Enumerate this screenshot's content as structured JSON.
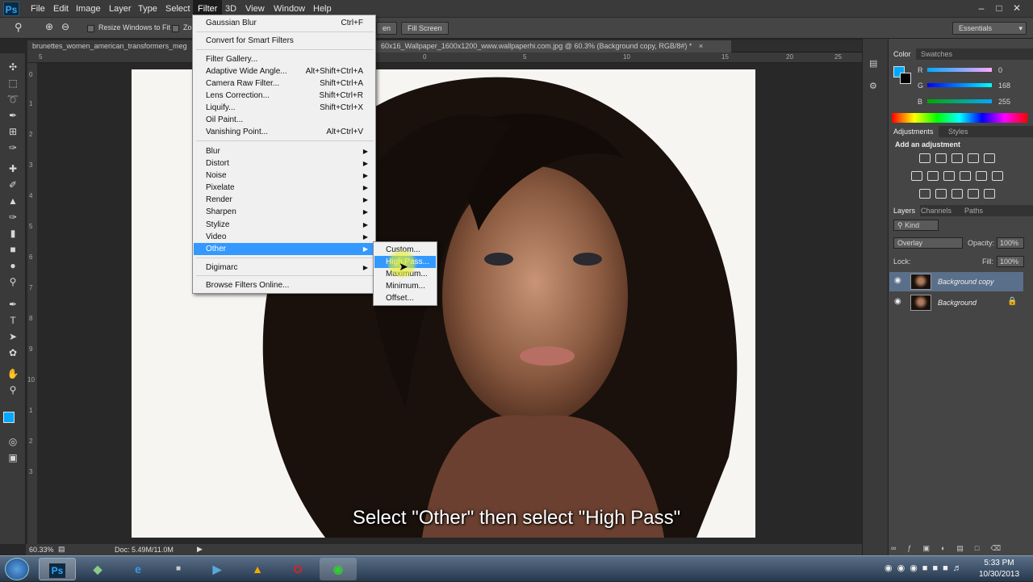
{
  "app": {
    "logo": "Ps"
  },
  "menubar": {
    "items": [
      "File",
      "Edit",
      "Image",
      "Layer",
      "Type",
      "Select",
      "Filter",
      "3D",
      "View",
      "Window",
      "Help"
    ],
    "active": "Filter"
  },
  "options": {
    "resize_windows": "Resize Windows to Fit",
    "zoom_all": "Zoo",
    "fill_screen": "Fill Screen",
    "fit_screen_partial": "en",
    "workspace": "Essentials"
  },
  "document": {
    "tab1": "brunettes_women_american_transformers_meg",
    "tab2": "60x16_Wallpaper_1600x1200_www.wallpaperhi.com.jpg @ 60.3% (Background copy, RGB/8#) *",
    "close": "×"
  },
  "ruler": {
    "top": [
      "5",
      "0",
      "5",
      "10",
      "15",
      "20",
      "25"
    ],
    "left": [
      "0",
      "1",
      "2",
      "3",
      "4",
      "5",
      "6",
      "7",
      "8",
      "9",
      "10",
      "1",
      "2",
      "3"
    ]
  },
  "status": {
    "zoom": "60.33%",
    "doc": "Doc: 5.49M/11.0M"
  },
  "filter_menu": {
    "last_filter": "Gaussian Blur",
    "last_filter_sc": "Ctrl+F",
    "smart": "Convert for Smart Filters",
    "gallery": "Filter Gallery...",
    "adaptive": "Adaptive Wide Angle...",
    "adaptive_sc": "Alt+Shift+Ctrl+A",
    "camera_raw": "Camera Raw Filter...",
    "camera_raw_sc": "Shift+Ctrl+A",
    "lens": "Lens Correction...",
    "lens_sc": "Shift+Ctrl+R",
    "liquify": "Liquify...",
    "liquify_sc": "Shift+Ctrl+X",
    "oil": "Oil Paint...",
    "vanishing": "Vanishing Point...",
    "vanishing_sc": "Alt+Ctrl+V",
    "blur": "Blur",
    "distort": "Distort",
    "noise": "Noise",
    "pixelate": "Pixelate",
    "render": "Render",
    "sharpen": "Sharpen",
    "stylize": "Stylize",
    "video": "Video",
    "other": "Other",
    "digimarc": "Digimarc",
    "browse": "Browse Filters Online..."
  },
  "other_submenu": {
    "custom": "Custom...",
    "high_pass": "High Pass...",
    "maximum": "Maximum...",
    "minimum": "Minimum...",
    "offset": "Offset..."
  },
  "color_panel": {
    "tab_color": "Color",
    "tab_swatches": "Swatches",
    "r_label": "R",
    "g_label": "G",
    "b_label": "B",
    "r": "0",
    "g": "168",
    "b": "255",
    "foreground": "#00a8ff"
  },
  "adjustments_panel": {
    "tab_adjustments": "Adjustments",
    "tab_styles": "Styles",
    "heading": "Add an adjustment"
  },
  "layers_panel": {
    "tab_layers": "Layers",
    "tab_channels": "Channels",
    "tab_paths": "Paths",
    "kind": "Kind",
    "blend_mode": "Overlay",
    "opacity_label": "Opacity:",
    "opacity": "100%",
    "lock_label": "Lock:",
    "fill_label": "Fill:",
    "fill": "100%",
    "layers": [
      {
        "name": "Background copy",
        "selected": true
      },
      {
        "name": "Background",
        "selected": false
      }
    ]
  },
  "caption": "Select \"Other\" then select \"High Pass\"",
  "taskbar": {
    "time": "5:33 PM",
    "date": "10/30/2013",
    "ps": "Ps"
  }
}
